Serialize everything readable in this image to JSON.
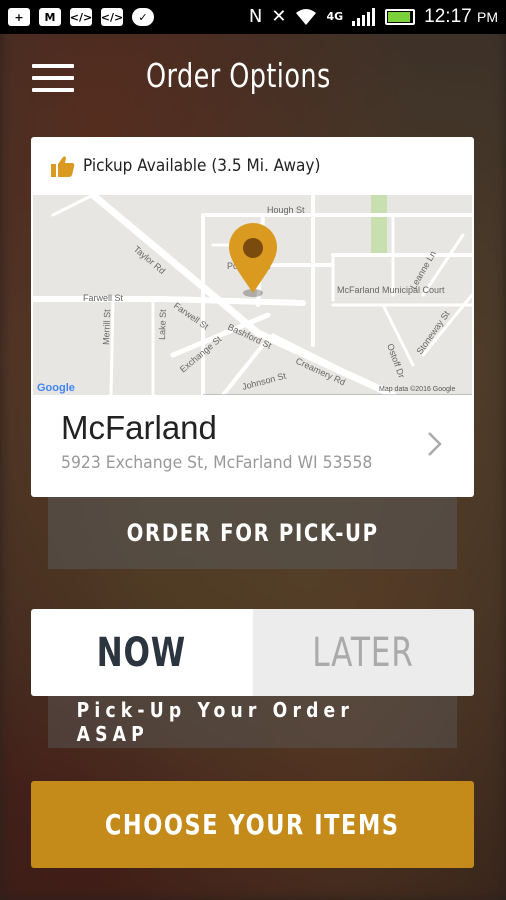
{
  "status_bar": {
    "time": "12:17",
    "ampm": "PM",
    "network": "4G",
    "icons": [
      "add-icon",
      "mail-icon",
      "code-icon",
      "code-icon",
      "chat-icon",
      "nfc-icon",
      "mute-icon",
      "wifi-icon",
      "signal-icon",
      "battery-icon"
    ]
  },
  "header": {
    "title": "Order Options",
    "menu_icon": "hamburger-menu-icon"
  },
  "card": {
    "availability": "Pickup Available (3.5 Mi. Away)",
    "map": {
      "streets": [
        "Hough St",
        "Taylor Rd",
        "Farwell St",
        "Farwell St",
        "Merrill St",
        "Lake St",
        "Exchange St",
        "Bashford St",
        "Johnson St",
        "Creamery Rd",
        "Leanne Ln",
        "Ostoff Dr",
        "Stoneway St"
      ],
      "places": [
        "Post Office",
        "McFarland Municipal Court"
      ],
      "brand": "Google",
      "attribution": "Map data ©2016 Google"
    },
    "location_name": "McFarland",
    "location_address": "5923 Exchange St, McFarland WI 53558"
  },
  "order_button": "ORDER FOR PICK-UP",
  "toggle": {
    "now": "NOW",
    "later": "LATER",
    "selected": "now"
  },
  "asap_text": "Pick-Up Your Order ASAP",
  "cta": "CHOOSE YOUR ITEMS",
  "colors": {
    "accent": "#c48b1a",
    "pin": "#d99a1f",
    "dark_text": "#2c3440"
  }
}
